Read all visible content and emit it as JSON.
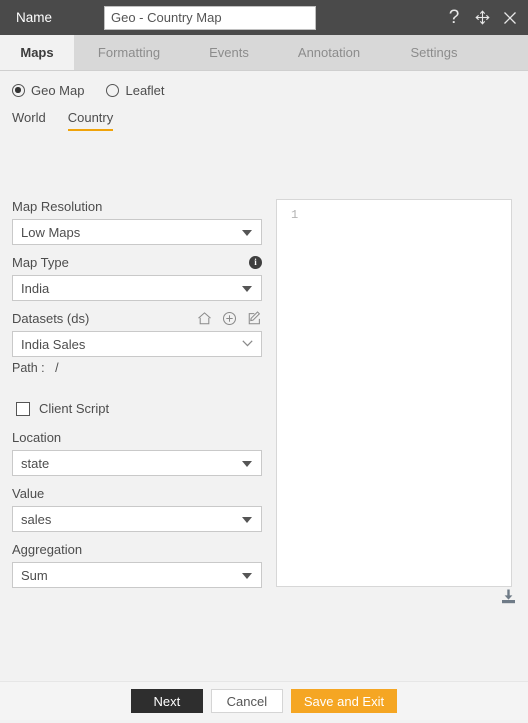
{
  "titlebar": {
    "label": "Name",
    "name_value": "Geo - Country Map",
    "name_placeholder": "Name",
    "help_icon": "question-mark-icon",
    "move_icon": "move-icon",
    "close_icon": "close-icon"
  },
  "tabs": [
    {
      "label": "Maps",
      "active": true
    },
    {
      "label": "Formatting",
      "active": false
    },
    {
      "label": "Events",
      "active": false
    },
    {
      "label": "Annotation",
      "active": false
    },
    {
      "label": "Settings",
      "active": false
    }
  ],
  "map_mode": {
    "options": [
      {
        "label": "Geo Map",
        "selected": true
      },
      {
        "label": "Leaflet",
        "selected": false
      }
    ]
  },
  "scope_tabs": [
    {
      "label": "World",
      "active": false
    },
    {
      "label": "Country",
      "active": true
    }
  ],
  "form": {
    "map_resolution": {
      "label": "Map Resolution",
      "value": "Low Maps"
    },
    "map_type": {
      "label": "Map Type",
      "value": "India",
      "info_icon": "info-icon"
    },
    "datasets": {
      "label": "Datasets (ds)",
      "value": "India Sales",
      "icons": [
        "home-icon",
        "add-circle-icon",
        "edit-icon"
      ],
      "path_label": "Path :",
      "path_value": "/"
    },
    "client_script": {
      "label": "Client Script",
      "checked": false
    },
    "location": {
      "label": "Location",
      "value": "state"
    },
    "value": {
      "label": "Value",
      "value": "sales"
    },
    "aggregation": {
      "label": "Aggregation",
      "value": "Sum"
    }
  },
  "editor": {
    "line_number": "1",
    "content": "",
    "download_icon": "download-icon"
  },
  "footer": {
    "next_label": "Next",
    "cancel_label": "Cancel",
    "save_label": "Save and Exit"
  },
  "colors": {
    "titlebar_bg": "#4a4a4a",
    "tabbar_bg": "#d8d8d8",
    "accent_orange": "#f0a30a",
    "save_button": "#f5a623",
    "next_button": "#2e2e2e",
    "page_bg": "#f2f2f2"
  }
}
